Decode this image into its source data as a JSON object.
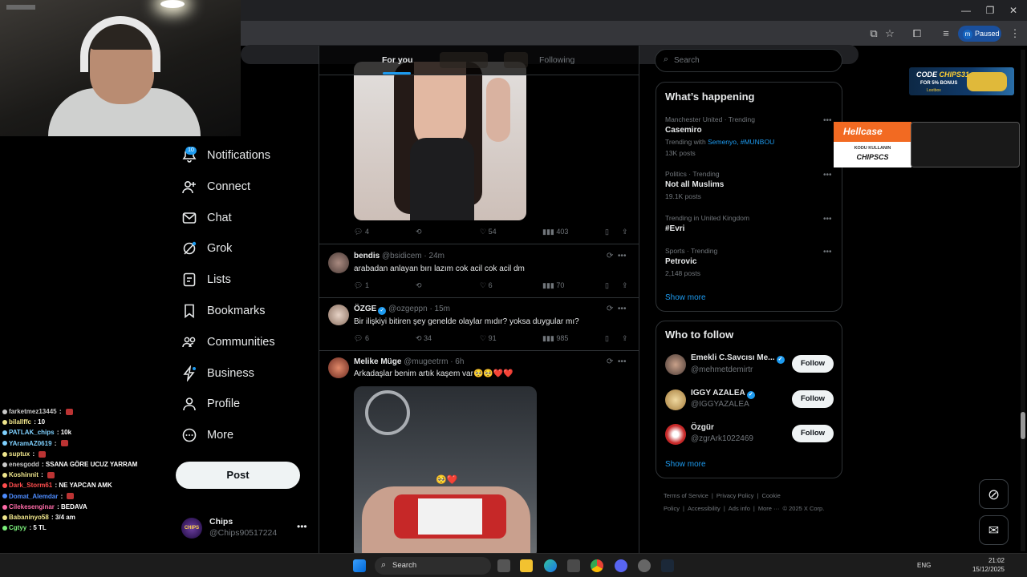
{
  "browser": {
    "profile_initial": "m",
    "profile_status": "Paused"
  },
  "chat": {
    "lines": [
      {
        "user": "farketmez13445",
        "msg": "",
        "color": "#c9c9c9"
      },
      {
        "user": "bilallffc",
        "msg": "10",
        "color": "#f0e68c"
      },
      {
        "user": "PATLAK_chips",
        "msg": "10k",
        "color": "#7fd1ff"
      },
      {
        "user": "YAramAZ0619",
        "msg": "",
        "color": "#7fd1ff"
      },
      {
        "user": "suptux",
        "msg": "",
        "color": "#f0e68c"
      },
      {
        "user": "enesgodd",
        "msg": "SSANA GÖRE UCUZ YARRAM",
        "color": "#c9c9c9"
      },
      {
        "user": "Koshinnit",
        "msg": "",
        "color": "#f0e68c"
      },
      {
        "user": "Dark_Storm61",
        "msg": "NE YAPCAN AMK",
        "color": "#ff4d4d"
      },
      {
        "user": "Domat_Alemdar",
        "msg": "",
        "color": "#4d8cff"
      },
      {
        "user": "Cilekesenginar",
        "msg": "BEDAVA",
        "color": "#ff6ba8"
      },
      {
        "user": "Babaninyo58",
        "msg": "3/4 am",
        "color": "#f0e68c"
      },
      {
        "user": "Cgtyy",
        "msg": "5 TL",
        "color": "#7cf07c"
      }
    ]
  },
  "sidebar": {
    "notif_badge": "10",
    "items": [
      {
        "label": "Notifications",
        "icon": "bell-icon"
      },
      {
        "label": "Connect",
        "icon": "person-plus-icon"
      },
      {
        "label": "Chat",
        "icon": "envelope-icon"
      },
      {
        "label": "Grok",
        "icon": "grok-icon"
      },
      {
        "label": "Lists",
        "icon": "list-icon"
      },
      {
        "label": "Bookmarks",
        "icon": "bookmark-icon"
      },
      {
        "label": "Communities",
        "icon": "people-icon"
      },
      {
        "label": "Business",
        "icon": "lightning-icon"
      },
      {
        "label": "Profile",
        "icon": "person-icon"
      },
      {
        "label": "More",
        "icon": "more-circle-icon"
      }
    ],
    "post_label": "Post",
    "account": {
      "name": "Chips",
      "handle": "@Chips90517224",
      "avatar_text": "CHIPS"
    }
  },
  "timeline": {
    "tabs": [
      "For you",
      "Following"
    ],
    "tweet1_stats": {
      "replies": "4",
      "retweets": "",
      "likes": "54",
      "views": "403"
    },
    "tweets": [
      {
        "name": "bendis",
        "handle": "@bsidicem",
        "time": "· 24m",
        "text": "arabadan anlayan bırı lazım cok acil cok acil dm",
        "replies": "1",
        "retweets": "",
        "likes": "6",
        "views": "70"
      },
      {
        "name": "ÖZGE",
        "handle": "@ozgeppn",
        "time": "· 15m",
        "text": "Bir ilişkiyi bitiren şey genelde olaylar mıdır? yoksa duygular mı?",
        "replies": "6",
        "retweets": "34",
        "likes": "91",
        "views": "985"
      },
      {
        "name": "Melike Müge",
        "handle": "@mugeetrm",
        "time": "· 6h",
        "text": "Arkadaşlar benim artık kaşem var🥺🥺❤️❤️"
      }
    ],
    "photo2_emoji": "🥺❤️"
  },
  "right": {
    "search_placeholder": "Search",
    "happening_title": "What’s happening",
    "trends": [
      {
        "meta": "Manchester United · Trending",
        "topic": "Casemiro",
        "with_label": "Trending with",
        "with_links": "Semenyo, #MUNBOU",
        "posts": "13K posts"
      },
      {
        "meta": "Politics · Trending",
        "topic": "Not all Muslims",
        "posts": "19.1K posts"
      },
      {
        "meta": "Trending in United Kingdom",
        "topic": "#Evri",
        "posts": ""
      },
      {
        "meta": "Sports · Trending",
        "topic": "Petrovic",
        "posts": "2,148 posts"
      }
    ],
    "show_more": "Show more",
    "wtf_title": "Who to follow",
    "follow_label": "Follow",
    "who_to_follow": [
      {
        "name": "Emekli C.Savcısı Me...",
        "handle": "@mehmetdemirtr"
      },
      {
        "name": "IGGY AZALEA",
        "handle": "@IGGYAZALEA"
      },
      {
        "name": "Özgür",
        "handle": "@zgrArk1022469"
      }
    ],
    "footer": [
      "Terms of Service",
      "|",
      "Privacy Policy",
      "|",
      "Cookie Policy",
      "|",
      "Accessibility",
      "|",
      "Ads info",
      "|",
      "More ···",
      "© 2025 X Corp."
    ]
  },
  "ads": {
    "code_line": "CODE",
    "code_value": "CHIPS31",
    "bonus": "FOR 5% BONUS",
    "brand": "Lootbox",
    "hellcase": "Hellcase",
    "kodu": "KODU KULLANIN",
    "hell_code": "CHIPSCS"
  },
  "taskbar": {
    "search": "Search",
    "lang": "ENG",
    "time": "21:02",
    "date": "15/12/2025"
  }
}
